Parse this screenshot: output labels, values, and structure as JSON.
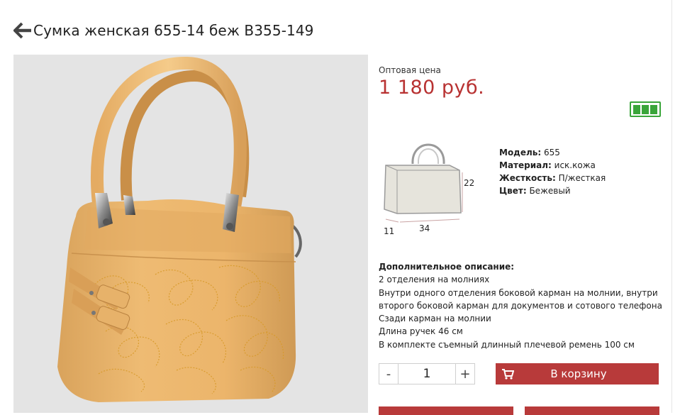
{
  "header": {
    "title": "Сумка женская 655-14 беж B355-149",
    "back_icon": "arrow-left-icon"
  },
  "product": {
    "price_label": "Оптовая цена",
    "price": "1 180 руб.",
    "stock_icon": "stock-level-icon",
    "scheme": {
      "height": "22",
      "depth": "11",
      "width": "34"
    },
    "properties": [
      {
        "label": "Модель:",
        "value": "655"
      },
      {
        "label": "Материал:",
        "value": "иск.кожа"
      },
      {
        "label": "Жесткость:",
        "value": "П/жесткая"
      },
      {
        "label": "Цвет:",
        "value": "Бежевый"
      }
    ],
    "description": {
      "heading": "Дополнительное описание:",
      "lines": [
        "2 отделения на молниях",
        "Внутри одного отделения боковой карман на молнии, внутри",
        "второго боковой карман для документов и сотового телефона",
        "Сзади карман на молнии",
        "Длина ручек 46 см",
        "В комплекте съемный длинный плечевой ремень 100 см"
      ]
    }
  },
  "cart": {
    "minus": "-",
    "quantity": "1",
    "plus": "+",
    "add_label": "В корзину",
    "cart_icon": "cart-icon"
  },
  "colors": {
    "price": "#b83232",
    "button": "#b83a3a",
    "stock": "#3aa53a"
  }
}
